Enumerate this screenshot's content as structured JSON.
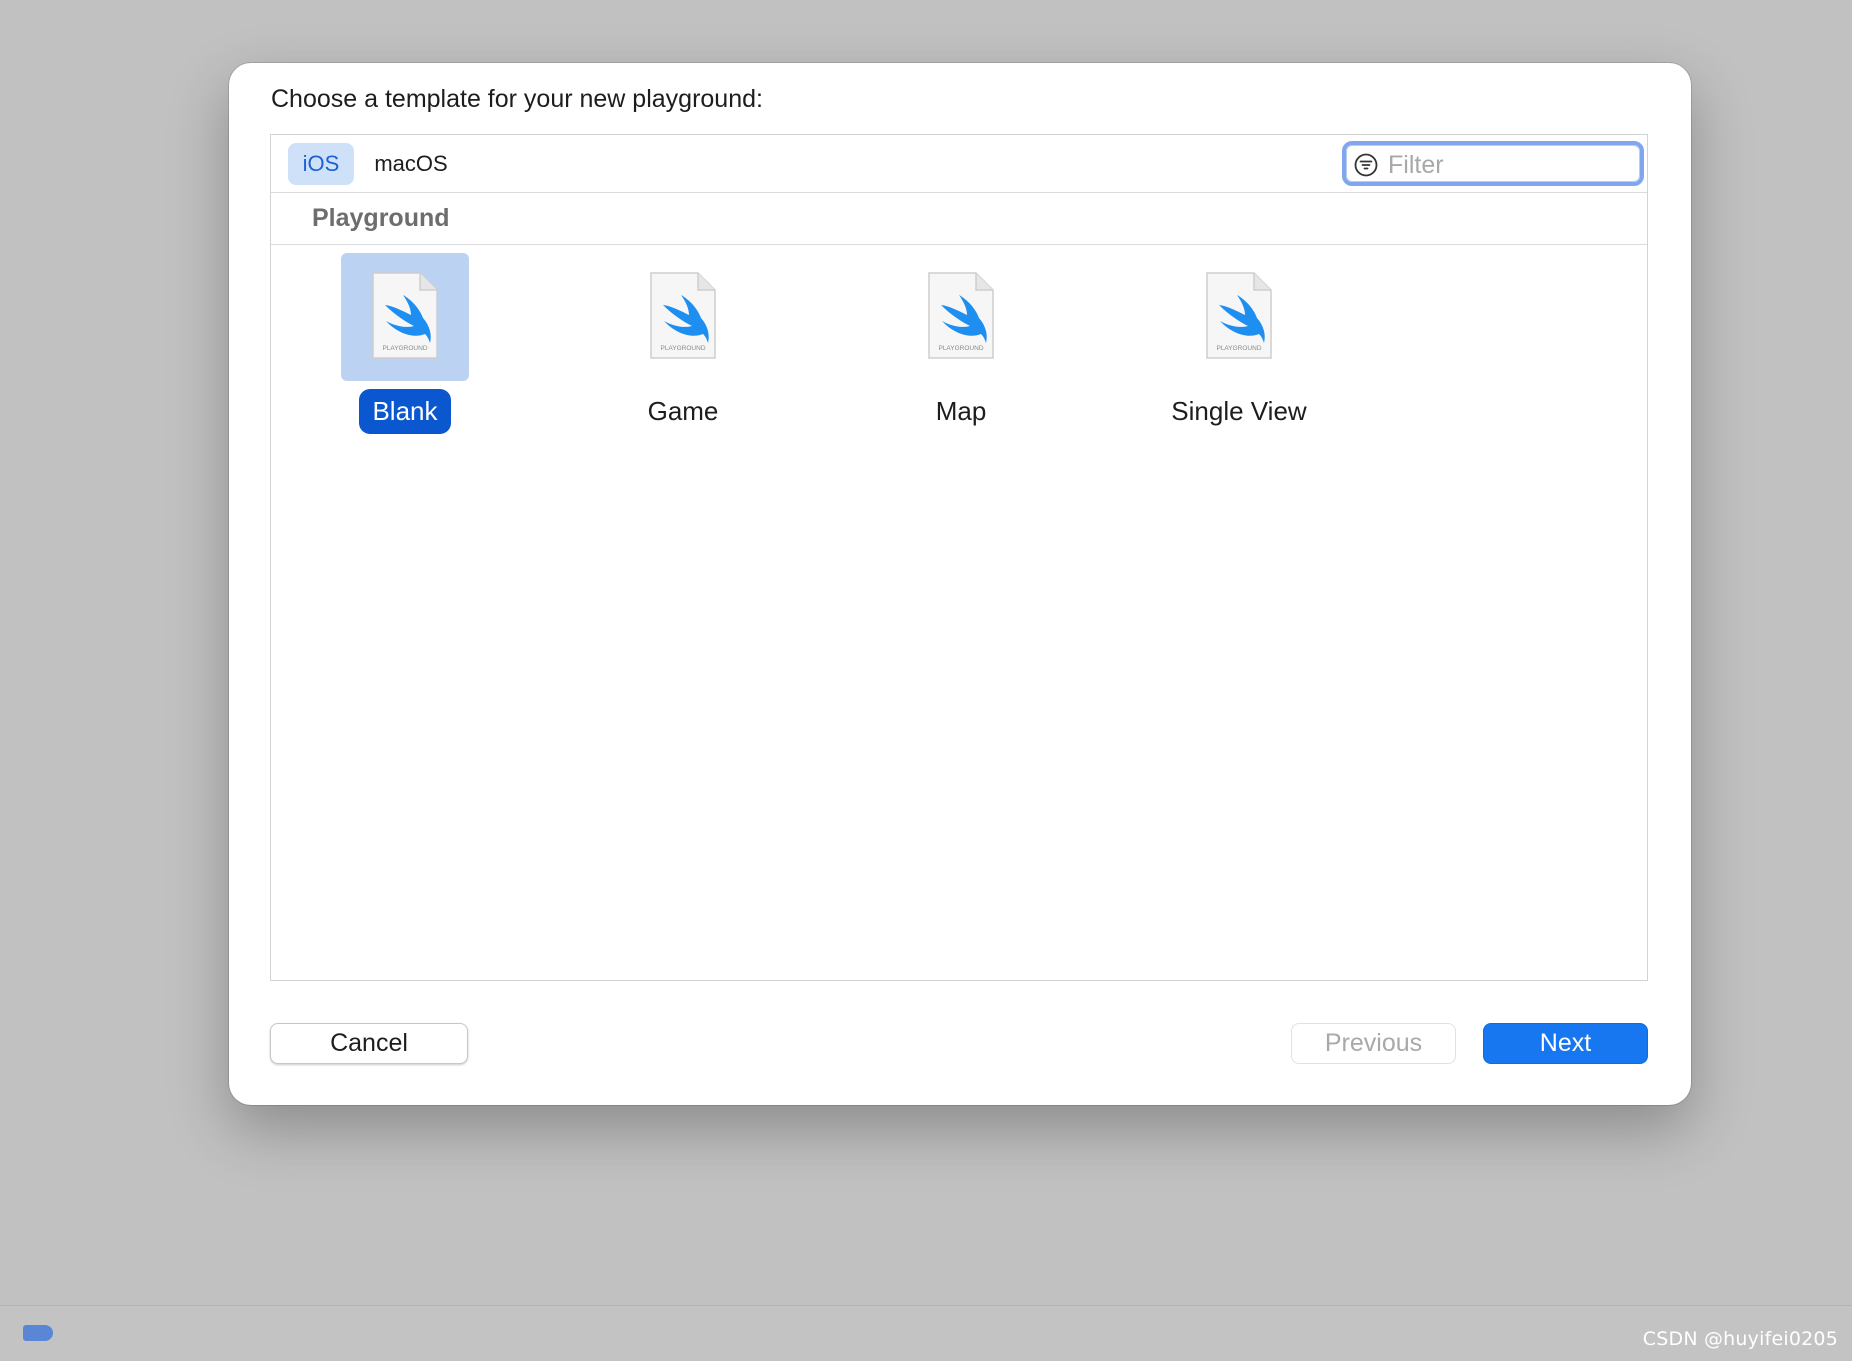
{
  "dialog": {
    "title": "Choose a template for your new playground:"
  },
  "platforms": {
    "tabs": [
      {
        "label": "iOS",
        "selected": true
      },
      {
        "label": "macOS",
        "selected": false
      }
    ]
  },
  "filter": {
    "placeholder": "Filter",
    "value": ""
  },
  "section": {
    "title": "Playground"
  },
  "templates": [
    {
      "name": "Blank",
      "icon": "swift-playground-icon",
      "icon_caption": "PLAYGROUND",
      "selected": true
    },
    {
      "name": "Game",
      "icon": "swift-playground-icon",
      "icon_caption": "PLAYGROUND",
      "selected": false
    },
    {
      "name": "Map",
      "icon": "swift-playground-icon",
      "icon_caption": "PLAYGROUND",
      "selected": false
    },
    {
      "name": "Single View",
      "icon": "swift-playground-icon",
      "icon_caption": "PLAYGROUND",
      "selected": false
    }
  ],
  "buttons": {
    "cancel": "Cancel",
    "previous": "Previous",
    "previous_enabled": false,
    "next": "Next"
  },
  "colors": {
    "accent": "#1677f0",
    "selection": "#0b57d0",
    "swift": "#1e8ff0"
  },
  "watermark": "CSDN @huyifei0205"
}
